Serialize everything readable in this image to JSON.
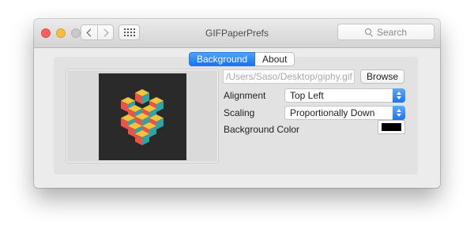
{
  "window": {
    "title": "GIFPaperPrefs"
  },
  "toolbar": {
    "search_placeholder": "Search"
  },
  "tabs": [
    {
      "label": "Background",
      "active": true
    },
    {
      "label": "About",
      "active": false
    }
  ],
  "background": {
    "file_path": "/Users/Saso/Desktop/giphy.gif",
    "browse_label": "Browse",
    "alignment_label": "Alignment",
    "alignment_value": "Top Left",
    "scaling_label": "Scaling",
    "scaling_value": "Proportionally Down",
    "color_label": "Background Color",
    "color_value": "#000000"
  },
  "icons": {
    "back": "chevron-left-icon",
    "forward": "chevron-right-icon",
    "show_all": "grid-icon",
    "search": "search-icon"
  }
}
